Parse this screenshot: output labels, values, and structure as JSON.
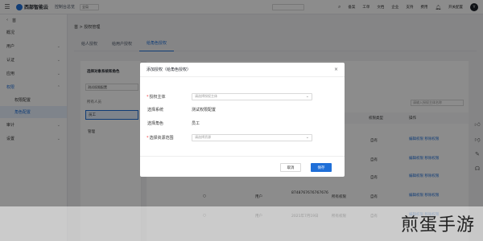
{
  "topbar": {
    "menu_icon": "menu-icon",
    "logo_text": "西部智能云",
    "product": "控制台总览",
    "region": "全局",
    "right_items": [
      "备案",
      "工单",
      "文档",
      "企业",
      "支持",
      "费用"
    ],
    "settings": "开关配置",
    "avatar": "Y"
  },
  "sidebar": {
    "back_icon": "chevron-left-icon",
    "title": "首",
    "items": [
      {
        "label": "概况"
      },
      {
        "label": "用户"
      },
      {
        "label": "认证"
      },
      {
        "label": "应用"
      },
      {
        "label": "权限"
      }
    ],
    "subitems": [
      {
        "label": "权限配置"
      },
      {
        "label": "角色配置"
      }
    ],
    "items2": [
      {
        "label": "审计"
      },
      {
        "label": "设置"
      }
    ]
  },
  "main": {
    "breadcrumb": "首 > 授权管理",
    "tabs": [
      "给人授权",
      "给用户授权",
      "给角色授权"
    ],
    "left_panel": {
      "title": "选择对象系统和角色",
      "select_value": "测试权限配置",
      "column": "所有人员",
      "rows": [
        "员工",
        "管理"
      ]
    },
    "right_panel": {
      "search_placeholder": "请输入授权主体名称",
      "headers": [
        "权限类型",
        "操作"
      ],
      "rows": [
        {
          "type": "自有",
          "actions": "编辑权限 移除权限"
        },
        {
          "type": "自有",
          "actions": "编辑权限 移除权限"
        },
        {
          "type": "自有",
          "actions": "编辑权限 移除权限"
        },
        {
          "type": "自有",
          "actions": "编辑权限 移除权限"
        },
        {
          "type": "自有",
          "actions": "编辑权限 移除权限"
        }
      ],
      "bottom_rows": [
        {
          "col1": "用户",
          "col2": "8748767676767676",
          "col3": "所有权限",
          "col4": "自有",
          "col5": "编辑权限 移除权限"
        },
        {
          "col1": "用户",
          "col2": "2021年7月19日",
          "col3": "所有权限",
          "col4": "自有",
          "col5": "编辑权限 移除权限"
        }
      ]
    }
  },
  "modal": {
    "title": "添加授权（给角色授权）",
    "fields": [
      {
        "label": "授权主体",
        "required": true,
        "placeholder": "请选择授权主体"
      },
      {
        "label": "选择系统",
        "required": false,
        "value": "测试权限配置"
      },
      {
        "label": "选择角色",
        "required": false,
        "value": "员工"
      },
      {
        "label": "选择资源范围",
        "required": true,
        "placeholder": "请选择资源"
      }
    ],
    "cancel": "取消",
    "ok": "保存"
  },
  "watermark": "煎蛋手游",
  "colors": {
    "accent": "#1f6fd8",
    "required": "#f53f3f"
  }
}
